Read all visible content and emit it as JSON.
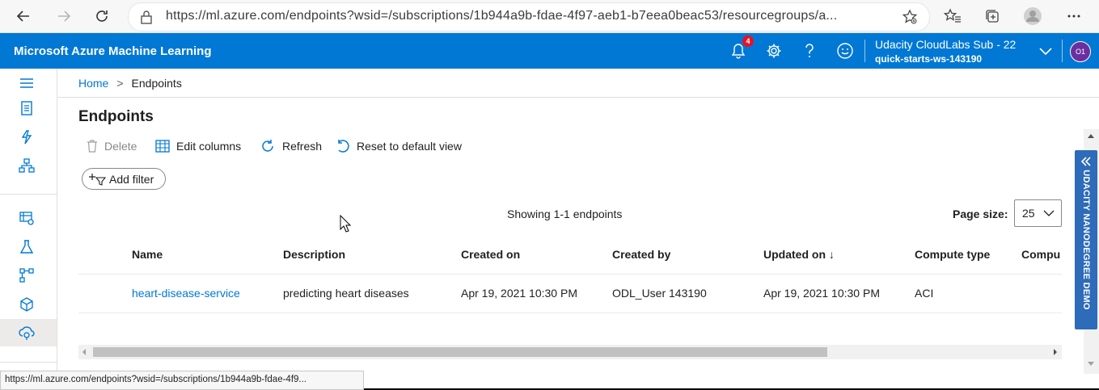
{
  "browser": {
    "url": "https://ml.azure.com/endpoints?wsid=/subscriptions/1b944a9b-fdae-4f97-aeb1-b7eea0beac53/resourcegroups/a..."
  },
  "header": {
    "app_title": "Microsoft Azure Machine Learning",
    "notification_count": "4",
    "subscription": "Udacity CloudLabs Sub - 22",
    "workspace": "quick-starts-ws-143190",
    "avatar_initials": "O1",
    "accent_color": "#0078d4"
  },
  "breadcrumb": {
    "home": "Home",
    "separator": ">",
    "current": "Endpoints"
  },
  "page": {
    "title": "Endpoints"
  },
  "toolbar": {
    "delete_label": "Delete",
    "edit_columns_label": "Edit columns",
    "refresh_label": "Refresh",
    "reset_label": "Reset to default view",
    "add_filter_label": "Add filter"
  },
  "pagination": {
    "showing_text": "Showing 1-1 endpoints",
    "page_size_label": "Page size:",
    "page_size_value": "25"
  },
  "table": {
    "columns": [
      "Name",
      "Description",
      "Created on",
      "Created by",
      "Updated on ↓",
      "Compute type",
      "Compu"
    ],
    "rows": [
      {
        "name": "heart-disease-service",
        "description": "predicting heart diseases",
        "created_on": "Apr 19, 2021 10:30 PM",
        "created_by": "ODL_User 143190",
        "updated_on": "Apr 19, 2021 10:30 PM",
        "compute_type": "ACI"
      }
    ]
  },
  "side_tab": {
    "label": "UDACITY NANODEGREE DEMO"
  },
  "status_bar": {
    "url": "https://ml.azure.com/endpoints?wsid=/subscriptions/1b944a9b-fdae-4f9..."
  },
  "icons": {
    "nav": [
      "hamburger-menu-icon",
      "notebook-icon",
      "automl-icon",
      "designer-icon",
      "datasets-icon",
      "experiments-icon",
      "pipelines-icon",
      "models-icon",
      "endpoints-icon"
    ]
  }
}
